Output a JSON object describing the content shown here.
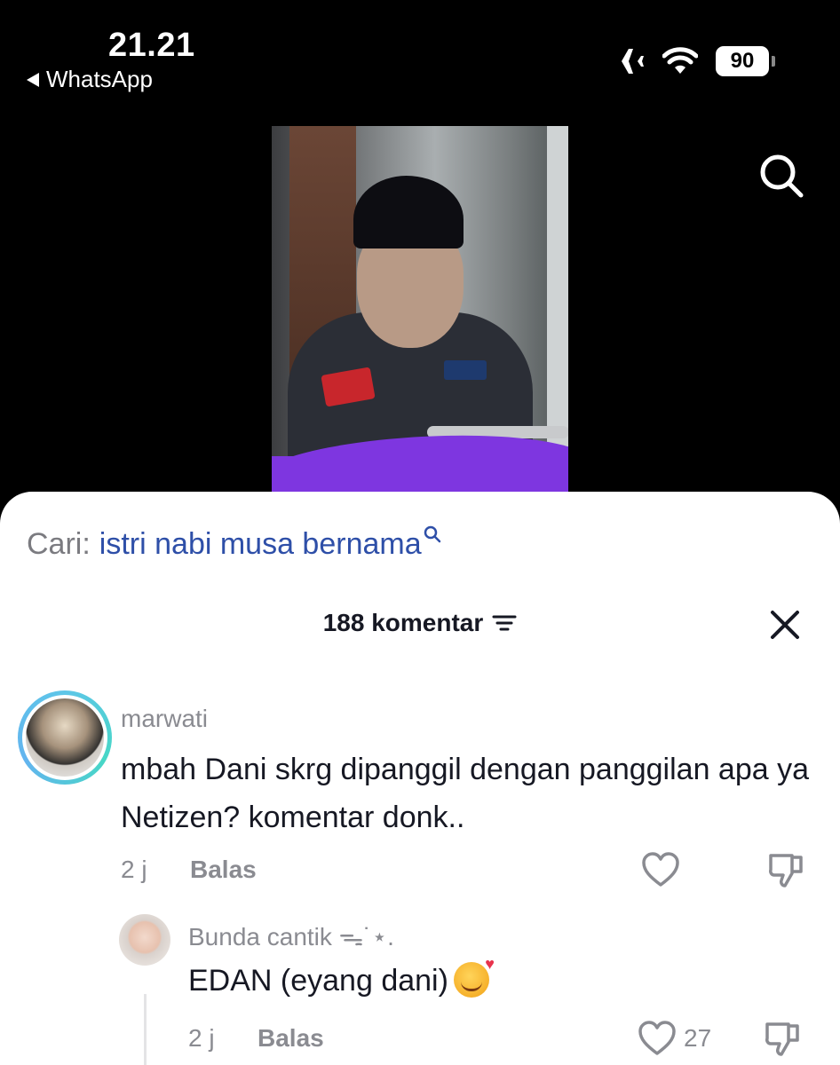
{
  "status_bar": {
    "time": "21.21",
    "back_app": "WhatsApp",
    "battery": "90",
    "icons": [
      "airplane-icon",
      "wifi-icon",
      "battery-icon"
    ]
  },
  "search": {
    "label": "Cari:",
    "query": "istri nabi musa bernama"
  },
  "comments_header": {
    "count_label": "188 komentar"
  },
  "comments": [
    {
      "username": "marwati",
      "text": "mbah Dani skrg dipanggil dengan panggilan apa ya Netizen? komentar donk..",
      "time": "2 j",
      "reply_label": "Balas",
      "likes": ""
    },
    {
      "username": "Bunda cantik ᯓ˙⋆.",
      "text": "EDAN (eyang dani)",
      "emoji": "smiling-face-with-hearts",
      "time": "2 j",
      "reply_label": "Balas",
      "likes": "27"
    }
  ],
  "colors": {
    "search_query": "#2e4fa8",
    "muted": "#8a8b91",
    "video_accent": "#7e36e0",
    "avatar_ring": "#5ec6e8"
  }
}
